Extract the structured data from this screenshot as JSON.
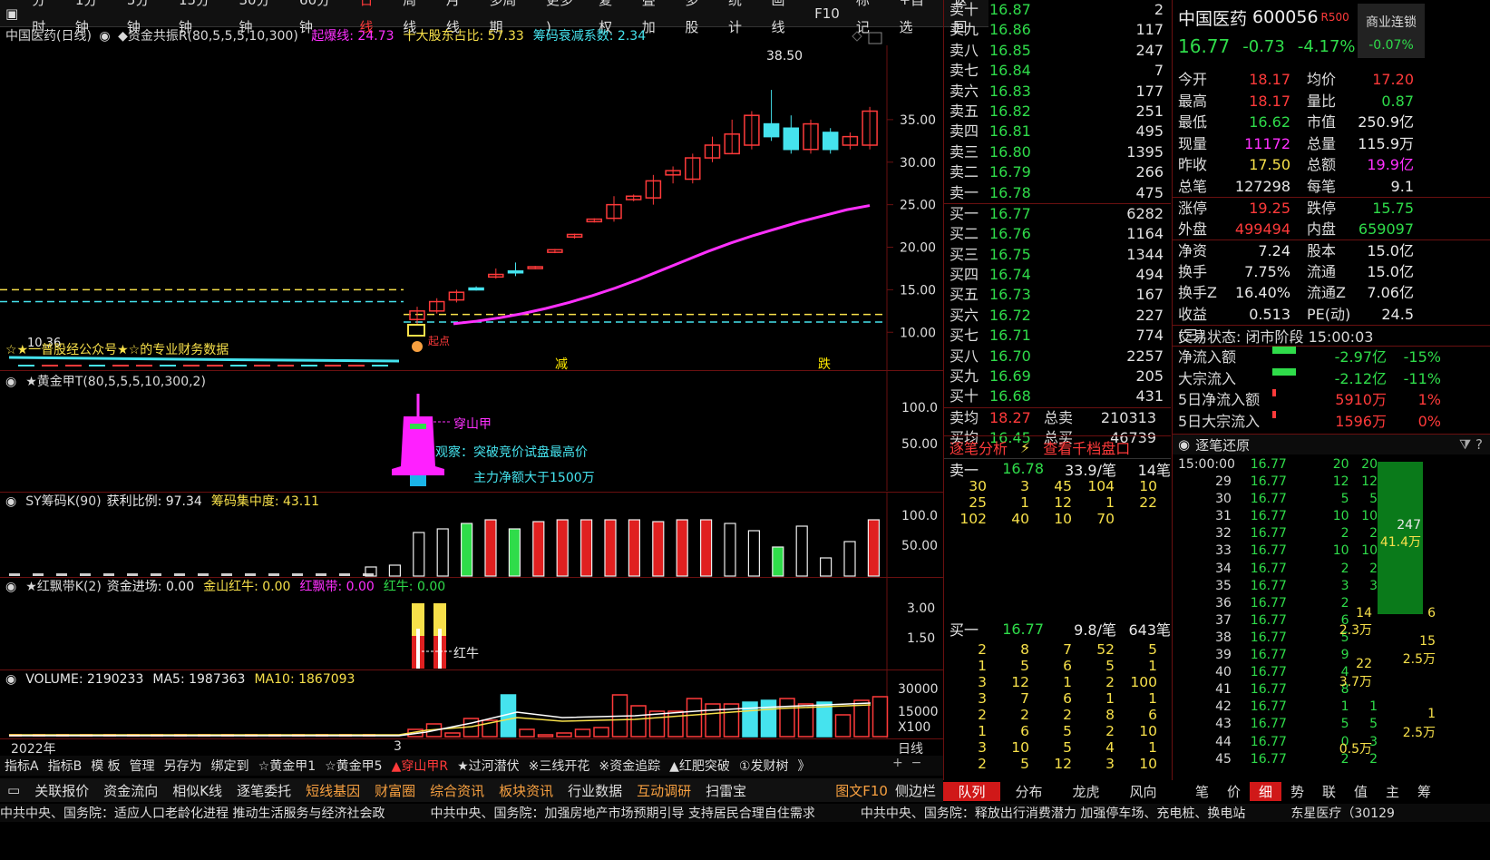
{
  "topbar": {
    "items": [
      "分时",
      "1分钟",
      "5分钟",
      "15分钟",
      "30分钟",
      "60分钟",
      "日线",
      "周线",
      "月线",
      "多周期",
      "更多 )"
    ],
    "active_index": 6,
    "right": [
      "复权",
      "叠加",
      "多股",
      "统计",
      "画线",
      "F10",
      "标记",
      "+自选",
      "返回"
    ]
  },
  "main": {
    "title": "中国医药(日线)",
    "indicator": "◆资金共振R(80,5,5,5,10,300)",
    "params": [
      {
        "text": "起爆线: 24.73",
        "color": "#ff30ff"
      },
      {
        "text": "十大股东占比: 57.33",
        "color": "#f7e04a"
      },
      {
        "text": "筹码衰减系数: 2.34",
        "color": "#45e3ee"
      }
    ],
    "y_ticks": [
      "35.00",
      "30.00",
      "25.00",
      "20.00",
      "15.00",
      "10.00"
    ],
    "peak_label": "38.50",
    "low_label": "10.36",
    "watermark": "☆★一普股经公众号★☆的专业财务数据",
    "marks": [
      "减",
      "跌"
    ],
    "bottom_marks": [
      "起",
      "点"
    ]
  },
  "chart_data": {
    "type": "candlestick",
    "ylim": [
      8,
      40
    ],
    "candles": [
      {
        "o": 11.5,
        "c": 12.5,
        "h": 13.0,
        "l": 11.0
      },
      {
        "o": 12.5,
        "c": 13.6,
        "h": 14.0,
        "l": 12.2
      },
      {
        "o": 13.8,
        "c": 14.7,
        "h": 15.0,
        "l": 13.5
      },
      {
        "o": 15.2,
        "c": 15.0,
        "h": 15.4,
        "l": 14.9
      },
      {
        "o": 16.5,
        "c": 16.8,
        "h": 17.5,
        "l": 16.3
      },
      {
        "o": 17.2,
        "c": 17.0,
        "h": 18.2,
        "l": 16.6
      },
      {
        "o": 17.5,
        "c": 17.7,
        "h": 17.8,
        "l": 17.4
      },
      {
        "o": 19.4,
        "c": 19.7,
        "h": 19.8,
        "l": 19.3
      },
      {
        "o": 21.2,
        "c": 21.5,
        "h": 21.6,
        "l": 21.0
      },
      {
        "o": 23.0,
        "c": 23.3,
        "h": 23.4,
        "l": 22.9
      },
      {
        "o": 23.4,
        "c": 25.0,
        "h": 26.0,
        "l": 23.0
      },
      {
        "o": 25.6,
        "c": 26.0,
        "h": 26.2,
        "l": 25.4
      },
      {
        "o": 25.8,
        "c": 27.8,
        "h": 28.5,
        "l": 25.0
      },
      {
        "o": 28.5,
        "c": 29.0,
        "h": 29.5,
        "l": 27.5
      },
      {
        "o": 28.0,
        "c": 30.5,
        "h": 31.0,
        "l": 27.5
      },
      {
        "o": 30.5,
        "c": 32.0,
        "h": 33.0,
        "l": 30.0
      },
      {
        "o": 31.0,
        "c": 33.3,
        "h": 35.0,
        "l": 31.0
      },
      {
        "o": 32.0,
        "c": 35.5,
        "h": 36.0,
        "l": 31.5
      },
      {
        "o": 34.5,
        "c": 33.0,
        "h": 38.5,
        "l": 32.5
      },
      {
        "o": 34.0,
        "c": 31.5,
        "h": 35.5,
        "l": 31.0
      },
      {
        "o": 31.5,
        "c": 34.5,
        "h": 35.0,
        "l": 31.0
      },
      {
        "o": 33.5,
        "c": 31.5,
        "h": 34.0,
        "l": 31.0
      },
      {
        "o": 32.0,
        "c": 33.0,
        "h": 33.5,
        "l": 31.5
      },
      {
        "o": 32.0,
        "c": 36.0,
        "h": 36.5,
        "l": 31.5
      }
    ]
  },
  "sub1": {
    "title": "★黄金甲T(80,5,5,5,10,300,2)",
    "y_ticks": [
      "100.0",
      "50.00"
    ],
    "labels": [
      "穿山甲",
      "观察：突破竞价试盘最高价",
      "主力净额大于1500万"
    ]
  },
  "sub2": {
    "title": "SY筹码K(90)",
    "p1": "获利比例: 97.34",
    "p2": "筹码集中度: 43.11",
    "y_ticks": [
      "100.0",
      "50.00"
    ]
  },
  "sub3": {
    "title": "★红飘带K(2)",
    "p1": "资金进场: 0.00",
    "p2": "金山红牛: 0.00",
    "p3": "红飘带: 0.00",
    "p4": "红牛: 0.00",
    "y_ticks": [
      "3.00",
      "1.50"
    ],
    "label": "红牛"
  },
  "sub4": {
    "title": "VOLUME: 2190233",
    "ma5": "MA5: 1987363",
    "ma10": "MA10: 1867093",
    "y_ticks": [
      "30000",
      "15000",
      "X100"
    ]
  },
  "xaxis": {
    "year": "2022年",
    "month": "3",
    "period": "日线"
  },
  "indbar": {
    "items": [
      "指标A",
      "指标B",
      "模 板",
      "管理",
      "另存为",
      "绑定到",
      "☆黄金甲1",
      "☆黄金甲5",
      "▲穿山甲R",
      "★过河潜伏",
      "※三线开花",
      "※资金追踪",
      "▲红肥突破",
      "①发财树",
      "》"
    ],
    "highlight": 8
  },
  "botbar": {
    "items": [
      "关联报价",
      "资金流向",
      "相似K线",
      "逐笔委托",
      "短线基因",
      "财富圈",
      "综合资讯",
      "板块资讯",
      "行业数据",
      "互动调研",
      "扫雷宝"
    ],
    "highlight": [
      4,
      5,
      6,
      7,
      9
    ],
    "right": [
      "图文F10",
      "侧边栏"
    ]
  },
  "ticker": {
    "items": [
      "中共中央、国务院：适应人口老龄化进程 推动生活服务与经济社会政",
      "中共中央、国务院：加强房地产市场预期引导 支持居民合理自住需求",
      "中共中央、国务院：释放出行消费潜力 加强停车场、充电桩、换电站",
      "东星医疗（30129"
    ]
  },
  "orderbook": {
    "asks": [
      [
        "卖十",
        "16.87",
        "2"
      ],
      [
        "卖九",
        "16.86",
        "117"
      ],
      [
        "卖八",
        "16.85",
        "247"
      ],
      [
        "卖七",
        "16.84",
        "7"
      ],
      [
        "卖六",
        "16.83",
        "177"
      ],
      [
        "卖五",
        "16.82",
        "251"
      ],
      [
        "卖四",
        "16.81",
        "495"
      ],
      [
        "卖三",
        "16.80",
        "1395"
      ],
      [
        "卖二",
        "16.79",
        "266"
      ],
      [
        "卖一",
        "16.78",
        "475"
      ]
    ],
    "bids": [
      [
        "买一",
        "16.77",
        "6282"
      ],
      [
        "买二",
        "16.76",
        "1164"
      ],
      [
        "买三",
        "16.75",
        "1344"
      ],
      [
        "买四",
        "16.74",
        "494"
      ],
      [
        "买五",
        "16.73",
        "167"
      ],
      [
        "买六",
        "16.72",
        "227"
      ],
      [
        "买七",
        "16.71",
        "774"
      ],
      [
        "买八",
        "16.70",
        "2257"
      ],
      [
        "买九",
        "16.69",
        "205"
      ],
      [
        "买十",
        "16.68",
        "431"
      ]
    ],
    "avg_sell": [
      "卖均",
      "18.27",
      "总卖",
      "210313"
    ],
    "avg_buy": [
      "买均",
      "16.45",
      "总买",
      "46739"
    ]
  },
  "analysis": {
    "tabs": [
      "逐笔分析",
      "查看千档盘口"
    ],
    "sell1": [
      "卖一",
      "16.78",
      "33.9/笔",
      "14笔"
    ],
    "sell_grid": [
      [
        "30",
        "3",
        "45",
        "104",
        "10"
      ],
      [
        "25",
        "1",
        "12",
        "1",
        "22"
      ],
      [
        "102",
        "40",
        "10",
        "70",
        ""
      ]
    ],
    "buy1": [
      "买一",
      "16.77",
      "9.8/笔",
      "643笔"
    ],
    "buy_grid": [
      [
        "2",
        "8",
        "7",
        "52",
        "5"
      ],
      [
        "1",
        "5",
        "6",
        "5",
        "1"
      ],
      [
        "3",
        "12",
        "1",
        "2",
        "100"
      ],
      [
        "3",
        "7",
        "6",
        "1",
        "1"
      ],
      [
        "2",
        "2",
        "2",
        "8",
        "6"
      ],
      [
        "1",
        "6",
        "5",
        "2",
        "10"
      ],
      [
        "3",
        "10",
        "5",
        "4",
        "1"
      ],
      [
        "2",
        "5",
        "12",
        "3",
        "10"
      ]
    ],
    "bottom_tabs": [
      "队列",
      "分布",
      "龙虎",
      "风向"
    ]
  },
  "quote": {
    "name": "中国医药",
    "code": "600056",
    "badge": "R500",
    "tag": "商业连锁",
    "tag_pct": "-0.07%",
    "price": "16.77",
    "chg": "-0.73",
    "pct": "-4.17%",
    "fields": [
      [
        "今开",
        "18.17",
        "red",
        "均价",
        "17.20",
        "red"
      ],
      [
        "最高",
        "18.17",
        "red",
        "量比",
        "0.87",
        "grn"
      ],
      [
        "最低",
        "16.62",
        "grn",
        "市值",
        "250.9亿",
        "wht"
      ],
      [
        "现量",
        "11172",
        "mag",
        "总量",
        "115.9万",
        "wht"
      ],
      [
        "昨收",
        "17.50",
        "yel",
        "总额",
        "19.9亿",
        "mag"
      ],
      [
        "总笔",
        "127298",
        "wht",
        "每笔",
        "9.1",
        "wht"
      ],
      [
        "涨停",
        "19.25",
        "red",
        "跌停",
        "15.75",
        "grn"
      ],
      [
        "外盘",
        "499494",
        "red",
        "内盘",
        "659097",
        "grn"
      ],
      [
        "净资",
        "7.24",
        "wht",
        "股本",
        "15.0亿",
        "wht"
      ],
      [
        "换手",
        "7.75%",
        "wht",
        "流通",
        "15.0亿",
        "wht"
      ],
      [
        "换手Z",
        "16.40%",
        "wht",
        "流通Z",
        "7.06亿",
        "wht"
      ],
      [
        "收益(三)",
        "0.513",
        "wht",
        "PE(动)",
        "24.5",
        "wht"
      ]
    ],
    "status": "交易状态: 闭市阶段 15:00:03",
    "flows": [
      [
        "净流入额",
        "-2.97亿",
        "-15%",
        "grn"
      ],
      [
        "大宗流入",
        "-2.12亿",
        "-11%",
        "grn"
      ],
      [
        "5日净流入额",
        "5910万",
        "1%",
        "red"
      ],
      [
        "5日大宗流入",
        "1596万",
        "0%",
        "red"
      ]
    ]
  },
  "ticks": {
    "title": "逐笔还原",
    "rows": [
      [
        "15:00:00",
        "16.77",
        "20",
        "20"
      ],
      [
        "29",
        "16.77",
        "12",
        "12"
      ],
      [
        "30",
        "16.77",
        "5",
        "5"
      ],
      [
        "31",
        "16.77",
        "10",
        "10"
      ],
      [
        "32",
        "16.77",
        "2",
        "2"
      ],
      [
        "33",
        "16.77",
        "10",
        "10"
      ],
      [
        "34",
        "16.77",
        "2",
        "2"
      ],
      [
        "35",
        "16.77",
        "3",
        "3"
      ],
      [
        "36",
        "16.77",
        "2",
        ""
      ],
      [
        "37",
        "16.77",
        "6",
        ""
      ],
      [
        "38",
        "16.77",
        "5",
        ""
      ],
      [
        "39",
        "16.77",
        "9",
        ""
      ],
      [
        "40",
        "16.77",
        "4",
        ""
      ],
      [
        "41",
        "16.77",
        "8",
        ""
      ],
      [
        "42",
        "16.77",
        "1",
        "1"
      ],
      [
        "43",
        "16.77",
        "5",
        "5"
      ],
      [
        "44",
        "16.77",
        "0",
        "3"
      ],
      [
        "45",
        "16.77",
        "2",
        "2"
      ]
    ],
    "side": [
      [
        "14",
        "6"
      ],
      [
        "2.3万",
        ""
      ],
      [
        "",
        "15"
      ],
      [
        "",
        "2.5万"
      ],
      [
        "22",
        ""
      ],
      [
        "3.7万",
        ""
      ],
      [
        "",
        "1"
      ],
      [
        "",
        "2.5万"
      ],
      [
        "0.5万",
        ""
      ]
    ],
    "bar": [
      "247",
      "41.4万"
    ],
    "tabs": [
      "笔",
      "价",
      "细",
      "势",
      "联",
      "值",
      "主",
      "筹"
    ],
    "active_tab": 2
  }
}
